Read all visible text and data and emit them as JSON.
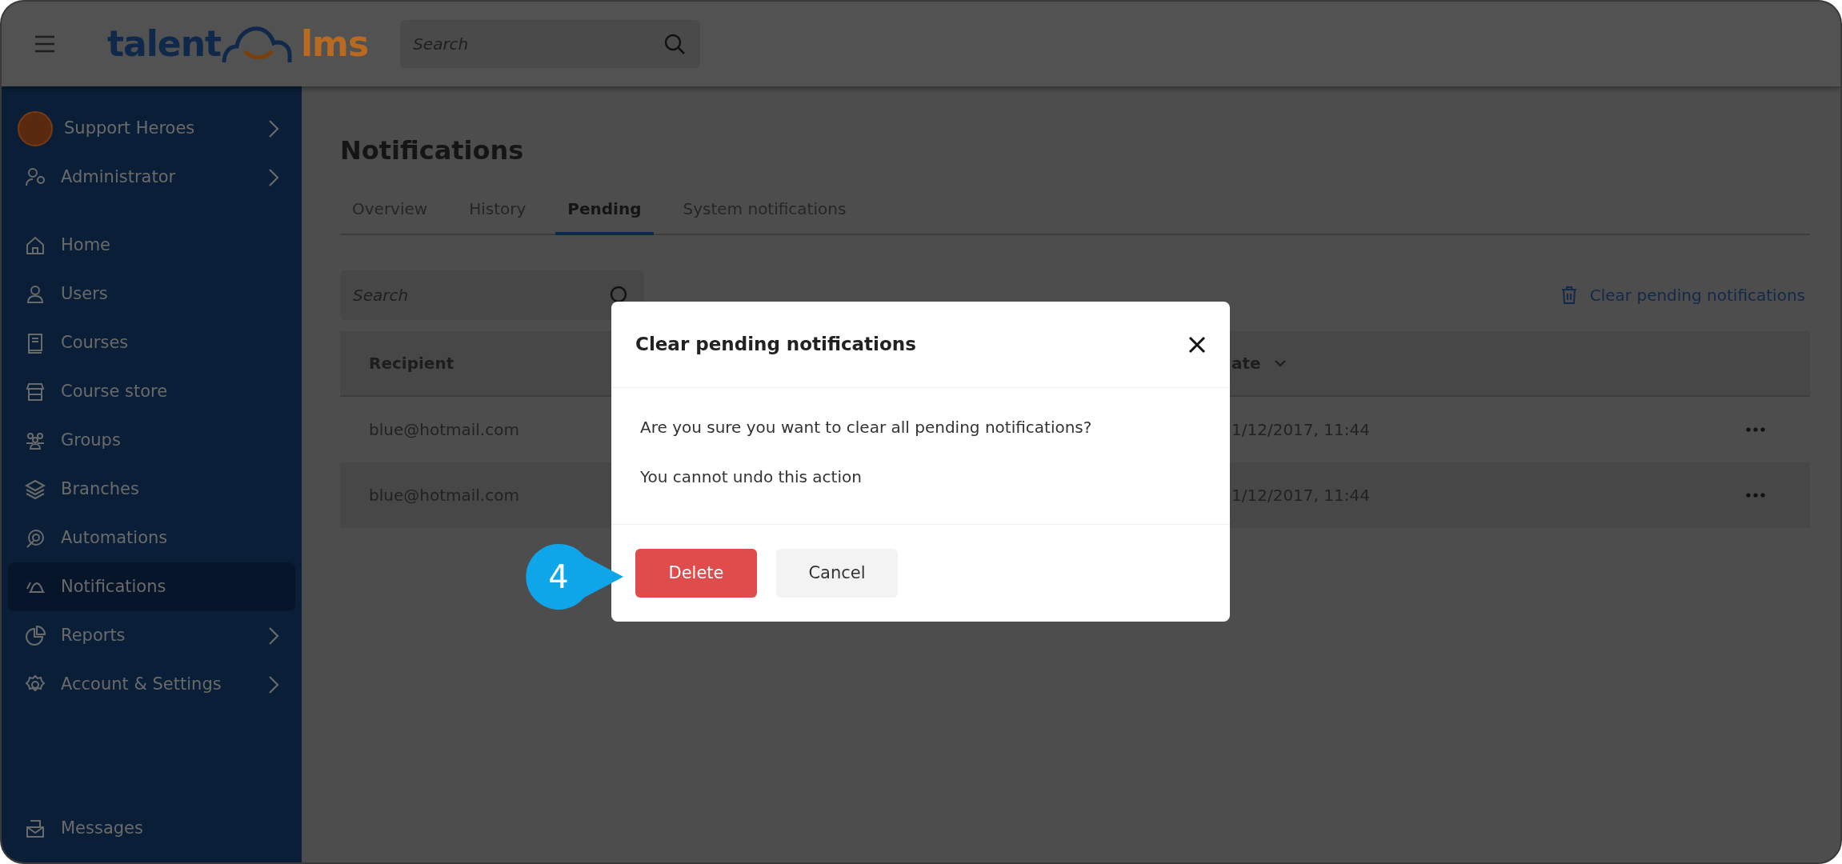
{
  "header": {
    "logo": {
      "left": "talent",
      "right": "lms"
    },
    "search": {
      "placeholder": "Search"
    }
  },
  "sidebar": {
    "account": {
      "name": "Support Heroes",
      "submenu": true
    },
    "role": {
      "label": "Administrator",
      "submenu": true
    },
    "items": [
      {
        "label": "Home",
        "selected": false,
        "submenu": false
      },
      {
        "label": "Users",
        "selected": false,
        "submenu": false
      },
      {
        "label": "Courses",
        "selected": false,
        "submenu": false
      },
      {
        "label": "Course store",
        "selected": false,
        "submenu": false
      },
      {
        "label": "Groups",
        "selected": false,
        "submenu": false
      },
      {
        "label": "Branches",
        "selected": false,
        "submenu": false
      },
      {
        "label": "Automations",
        "selected": false,
        "submenu": false
      },
      {
        "label": "Notifications",
        "selected": true,
        "submenu": false
      },
      {
        "label": "Reports",
        "selected": false,
        "submenu": true
      },
      {
        "label": "Account & Settings",
        "selected": false,
        "submenu": true
      }
    ],
    "footer": {
      "label": "Messages"
    }
  },
  "page": {
    "title": "Notifications",
    "tabs": [
      {
        "label": "Overview",
        "selected": false
      },
      {
        "label": "History",
        "selected": false
      },
      {
        "label": "Pending",
        "selected": true
      },
      {
        "label": "System notifications",
        "selected": false
      }
    ],
    "search": {
      "placeholder": "Search"
    },
    "clear_action": {
      "label": "Clear pending notifications"
    },
    "table": {
      "columns": [
        {
          "label": "Recipient",
          "sortable": false
        },
        {
          "label": "ate",
          "sortable": true
        }
      ],
      "rows": [
        {
          "recipient": "blue@hotmail.com",
          "date": "1/12/2017, 11:44"
        },
        {
          "recipient": "blue@hotmail.com",
          "date": "1/12/2017, 11:44"
        }
      ]
    }
  },
  "dialog": {
    "title": "Clear pending notifications",
    "messages": [
      "Are you sure you want to clear all pending notifications?",
      "You cannot undo this action"
    ],
    "buttons": [
      {
        "label": "Delete",
        "kind": "danger"
      },
      {
        "label": "Cancel",
        "kind": "secondary"
      }
    ]
  },
  "callout": {
    "label": "4"
  }
}
